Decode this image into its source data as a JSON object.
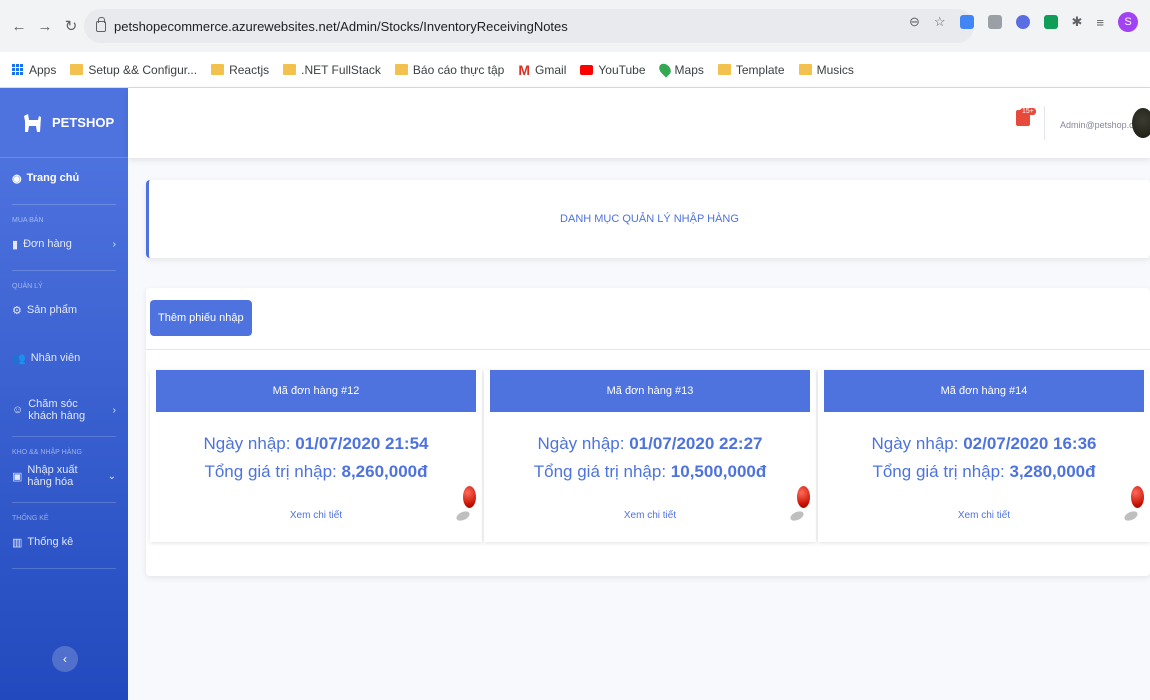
{
  "browser": {
    "url": "petshopecommerce.azurewebsites.net/Admin/Stocks/InventoryReceivingNotes",
    "profile_initial": "S",
    "bookmarks": [
      "Apps",
      "Setup && Configur...",
      "Reactjs",
      ".NET FullStack",
      "Báo cáo thực tập",
      "Gmail",
      "YouTube",
      "Maps",
      "Template",
      "Musics"
    ]
  },
  "sidebar": {
    "brand": "PETSHOP",
    "home": "Trang chủ",
    "section_sales": "MUA BÁN",
    "orders": "Đơn hàng",
    "section_manage": "QUẢN LÝ",
    "products": "Sản phẩm",
    "staff": "Nhân viên",
    "customer_care": "Chăm sóc khách hàng",
    "section_warehouse": "KHO && NHẬP HÀNG",
    "import_export": "Nhập xuất hàng hóa",
    "section_stats": "THỐNG KÊ",
    "stats": "Thống kê"
  },
  "topbar": {
    "alert_count": "15+",
    "email": "Admin@petshop.com"
  },
  "page": {
    "title": "DANH MỤC QUẢN LÝ NHẬP HÀNG",
    "add_button": "Thêm phiếu nhập"
  },
  "orders": [
    {
      "header": "Mã đơn hàng #12",
      "date_label": "Ngày nhập: ",
      "date": "01/07/2020 21:54",
      "total_label": "Tổng giá trị nhập: ",
      "total": "8,260,000đ",
      "link": "Xem chi tiết"
    },
    {
      "header": "Mã đơn hàng #13",
      "date_label": "Ngày nhập: ",
      "date": "01/07/2020 22:27",
      "total_label": "Tổng giá trị nhập: ",
      "total": "10,500,000đ",
      "link": "Xem chi tiết"
    },
    {
      "header": "Mã đơn hàng #14",
      "date_label": "Ngày nhập: ",
      "date": "02/07/2020 16:36",
      "total_label": "Tổng giá trị nhập: ",
      "total": "3,280,000đ",
      "link": "Xem chi tiết"
    }
  ],
  "colors": {
    "primary": "#4e73df",
    "danger": "#e74a3b"
  }
}
